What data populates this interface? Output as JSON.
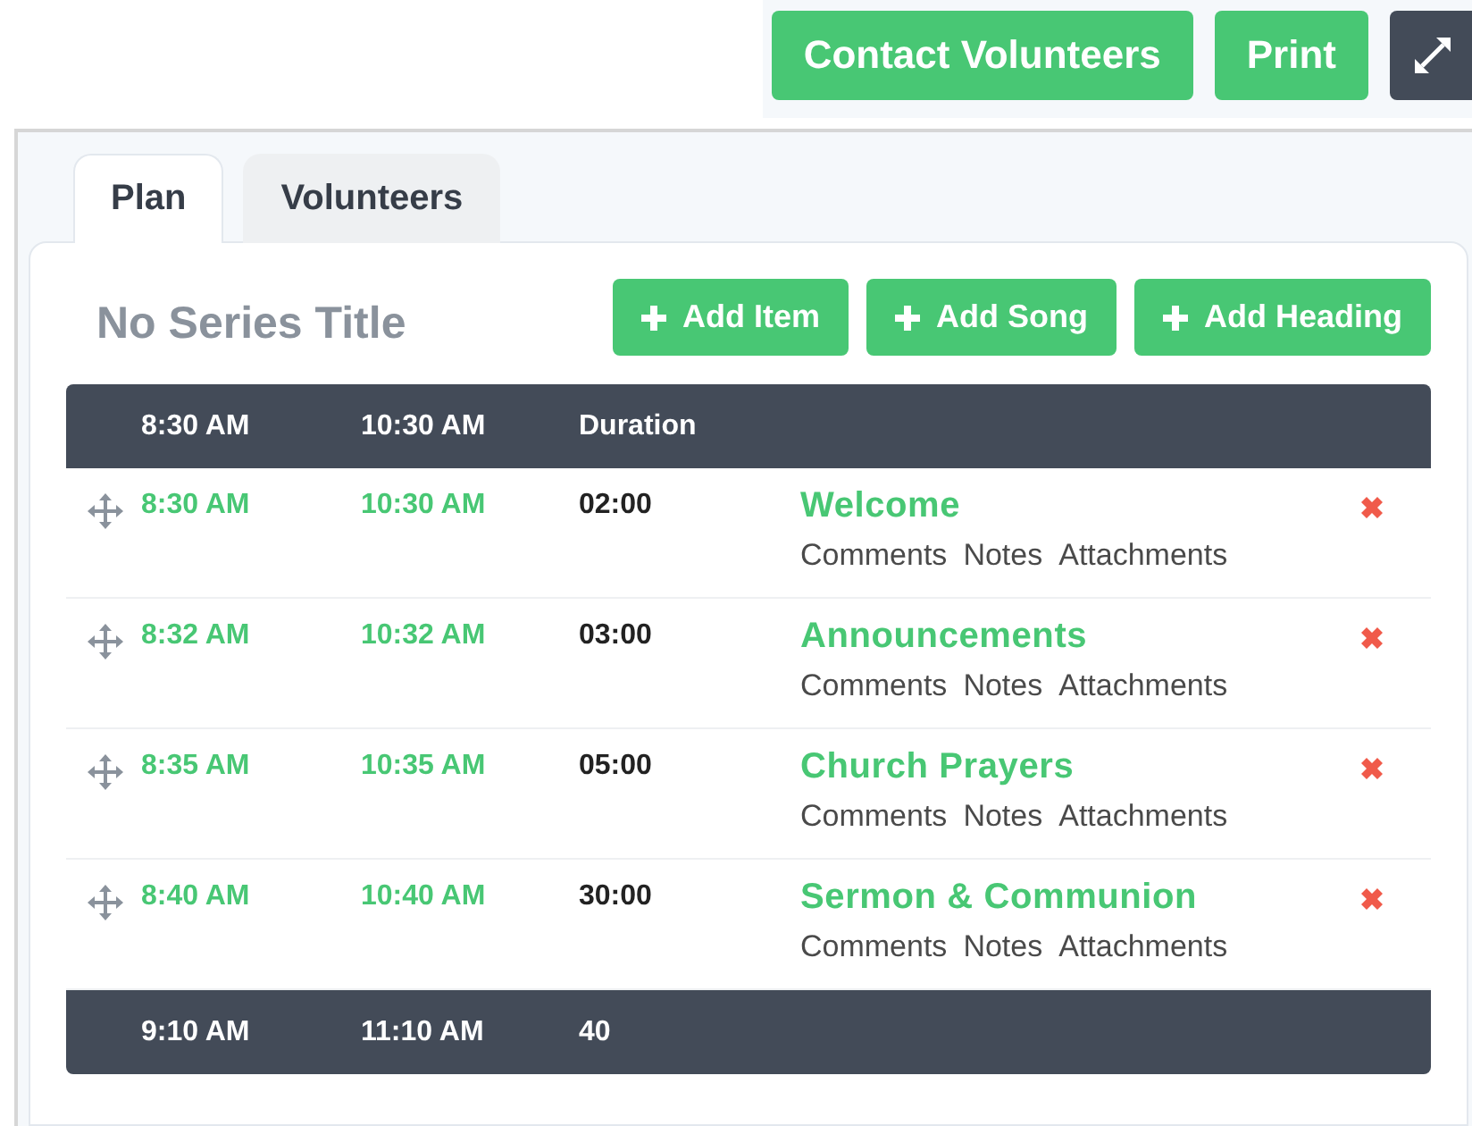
{
  "toolbar": {
    "buttons": [
      {
        "label": "Contact Volunteers",
        "kind": "text"
      },
      {
        "label": "Print",
        "kind": "text"
      },
      {
        "kind": "expand"
      }
    ]
  },
  "tabs": [
    {
      "label": "Plan",
      "selected": true
    },
    {
      "label": "Volunteers",
      "selected": false
    }
  ],
  "plan": {
    "title": "No Series Title",
    "actions": [
      {
        "label": "Add Item"
      },
      {
        "label": "Add Song"
      },
      {
        "label": "Add Heading"
      }
    ],
    "header": {
      "start": "8:30 AM",
      "end": "10:30 AM",
      "duration": "Duration"
    },
    "items": [
      {
        "start": "8:30 AM",
        "end": "10:30 AM",
        "duration": "02:00",
        "title": "Welcome",
        "links": [
          "Comments",
          "Notes",
          "Attachments"
        ]
      },
      {
        "start": "8:32 AM",
        "end": "10:32 AM",
        "duration": "03:00",
        "title": "Announcements",
        "links": [
          "Comments",
          "Notes",
          "Attachments"
        ]
      },
      {
        "start": "8:35 AM",
        "end": "10:35 AM",
        "duration": "05:00",
        "title": "Church Prayers",
        "links": [
          "Comments",
          "Notes",
          "Attachments"
        ]
      },
      {
        "start": "8:40 AM",
        "end": "10:40 AM",
        "duration": "30:00",
        "title": "Sermon & Communion",
        "links": [
          "Comments",
          "Notes",
          "Attachments"
        ]
      }
    ],
    "footer": {
      "start": "9:10 AM",
      "end": "11:10 AM",
      "duration": "40"
    }
  }
}
